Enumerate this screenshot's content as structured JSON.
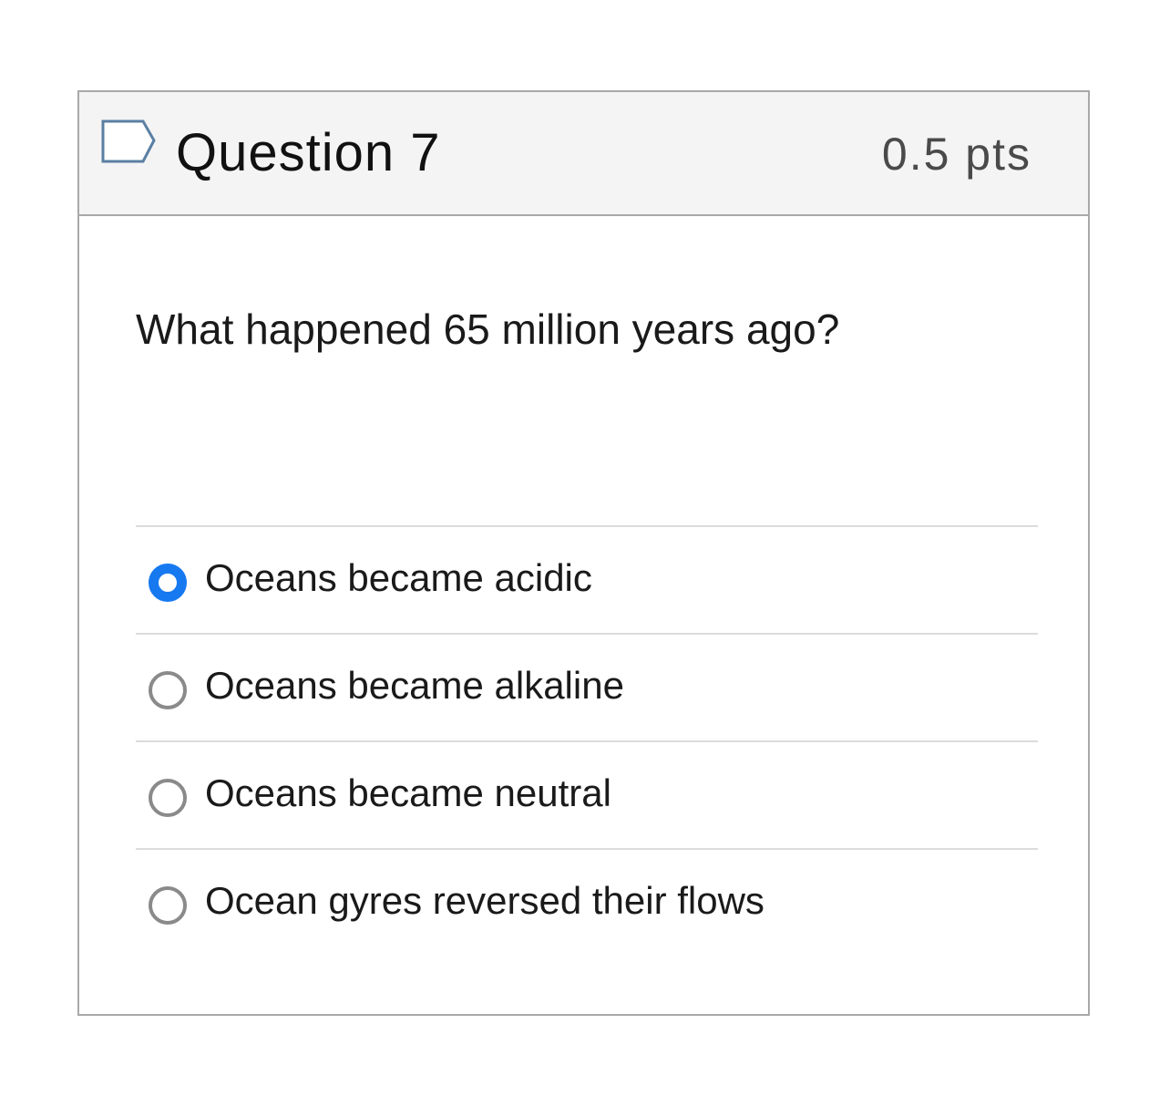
{
  "question": {
    "title": "Question 7",
    "points": "0.5 pts",
    "flag_icon": "flag-outline-icon",
    "text": "What happened 65 million years ago?",
    "answers": [
      {
        "label": "Oceans became acidic",
        "selected": true
      },
      {
        "label": "Oceans became alkaline",
        "selected": false
      },
      {
        "label": "Oceans became neutral",
        "selected": false
      },
      {
        "label": "Ocean gyres reversed their flows",
        "selected": false
      }
    ]
  },
  "colors": {
    "accent": "#1679f0",
    "header_bg": "#f4f4f4",
    "border": "#a9a9a9",
    "divider": "#dcdcdc"
  }
}
